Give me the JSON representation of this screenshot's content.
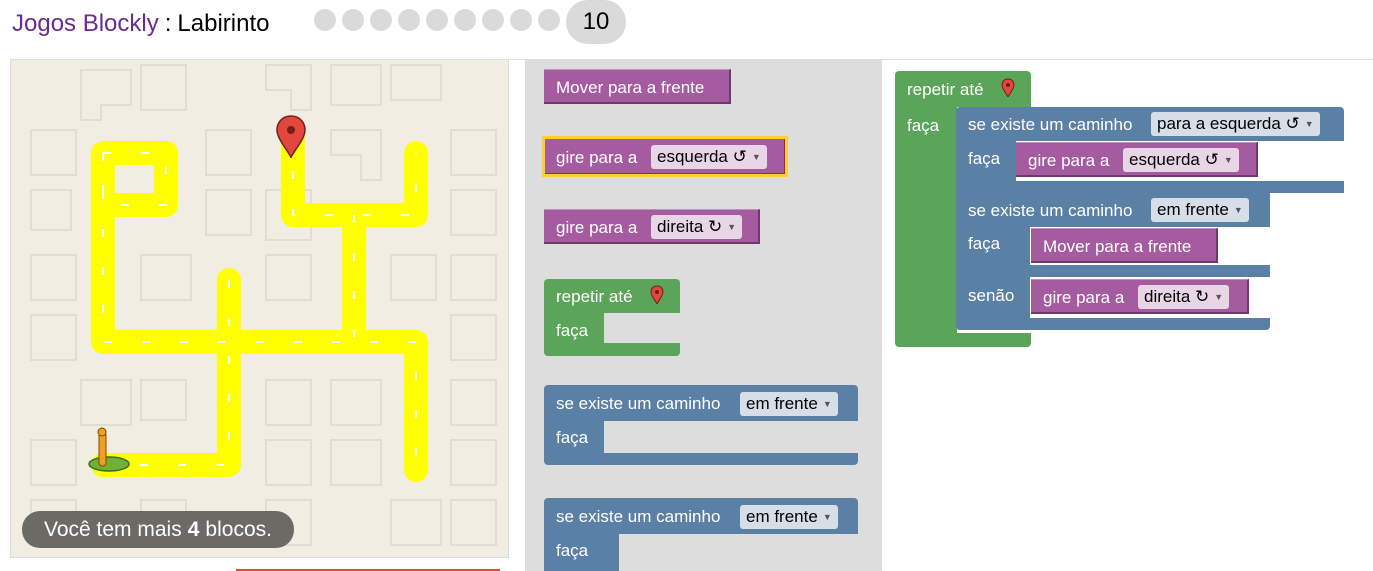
{
  "header": {
    "app_title": "Jogos Blockly",
    "separator": ":",
    "game_title": "Labirinto",
    "level_dots_count": 9,
    "current_level": "10"
  },
  "capacity": {
    "before": "Você tem mais",
    "count": "4",
    "after": "blocos."
  },
  "toolbox": {
    "move": "Mover para a frente",
    "turn_left": {
      "label": "gire para a",
      "value": "esquerda ↺"
    },
    "turn_right": {
      "label": "gire para a",
      "value": "direita ↻"
    },
    "repeat": {
      "label": "repetir até",
      "do": "faça"
    },
    "if1": {
      "label": "se existe um caminho",
      "value": "em frente",
      "do": "faça"
    },
    "if2": {
      "label": "se existe um caminho",
      "value": "em frente",
      "do": "faça"
    }
  },
  "workspace": {
    "repeat": {
      "label": "repetir até",
      "do": "faça"
    },
    "if_left": {
      "label": "se existe um caminho",
      "value": "para a esquerda ↺",
      "do": "faça",
      "turn_label": "gire para a",
      "turn_value": "esquerda ↺"
    },
    "if_else": {
      "label": "se existe um caminho",
      "value": "em frente",
      "do": "faça",
      "move": "Mover para a frente",
      "else": "senão",
      "turn_label": "gire para a",
      "turn_value": "direita ↻"
    }
  },
  "colors": {
    "path": "#ffff00",
    "purple": "#a55b9f",
    "green": "#5ba55b",
    "blue": "#5b80a5",
    "accent": "#6a2a91"
  }
}
